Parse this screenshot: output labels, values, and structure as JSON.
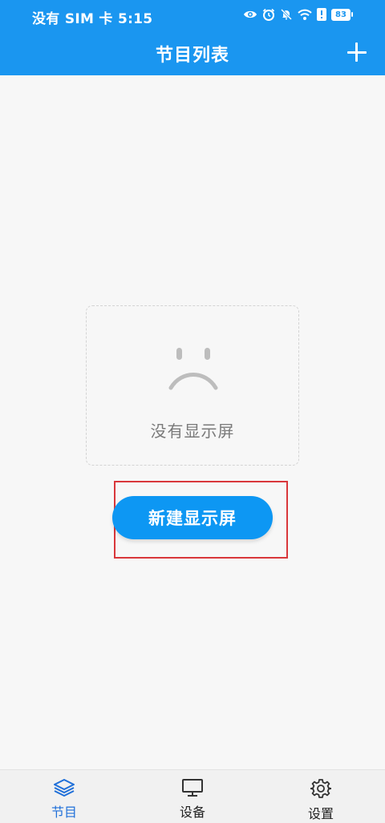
{
  "status_bar": {
    "left_text": "没有 SIM 卡 5:15",
    "battery_level": "83",
    "icons": [
      "eye-icon",
      "alarm-icon",
      "mute-bell-icon",
      "wifi-icon",
      "alert-icon",
      "battery-icon"
    ]
  },
  "header": {
    "title": "节目列表",
    "add_icon": "plus-icon"
  },
  "empty_state": {
    "icon": "sad-face-icon",
    "message": "没有显示屏"
  },
  "actions": {
    "create_label": "新建显示屏"
  },
  "bottom_nav": {
    "tabs": [
      {
        "label": "节目",
        "icon": "layers-icon",
        "active": true
      },
      {
        "label": "设备",
        "icon": "monitor-icon",
        "active": false
      },
      {
        "label": "设置",
        "icon": "gear-icon",
        "active": false
      }
    ]
  },
  "colors": {
    "primary": "#1a96f0",
    "button": "#0d97f3",
    "active_tab": "#1f6fd9",
    "highlight": "#d9373b"
  }
}
